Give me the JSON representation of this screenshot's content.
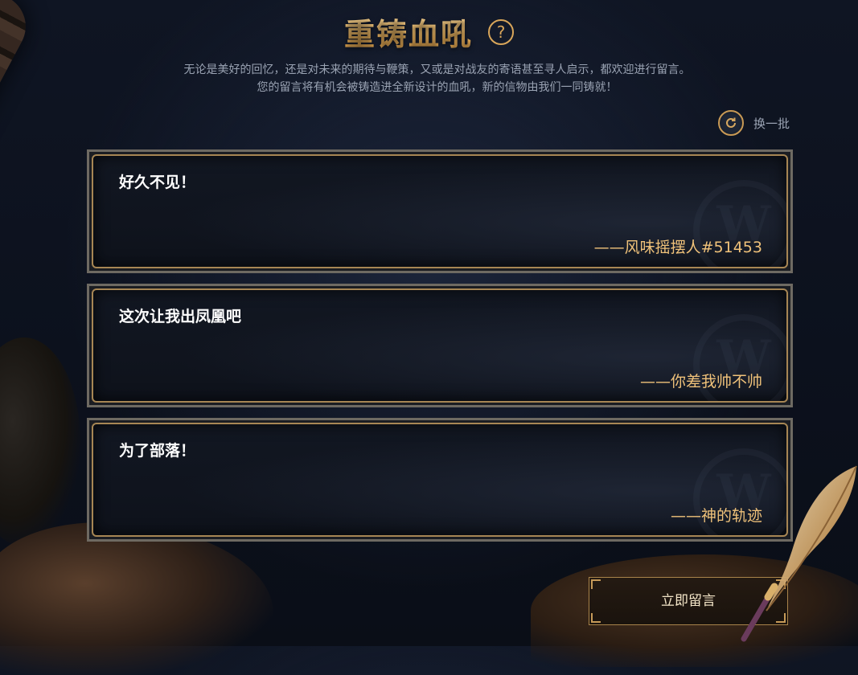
{
  "header": {
    "title": "重铸血吼",
    "help_icon": "question-circle-icon",
    "description_line1": "无论是美好的回忆，还是对未来的期待与鞭策，又或是对战友的寄语甚至寻人启示，都欢迎进行留言。",
    "description_line2": "您的留言将有机会被铸造进全新设计的血吼，新的信物由我们一同铸就！"
  },
  "refresh": {
    "icon": "refresh-icon",
    "label": "换一批"
  },
  "messages": [
    {
      "text": "好久不见！",
      "author": "——风味摇摆人#51453"
    },
    {
      "text": "这次让我出凤凰吧",
      "author": "——你差我帅不帅"
    },
    {
      "text": "为了部落！",
      "author": "——神的轨迹"
    }
  ],
  "cta": {
    "label": "立即留言"
  },
  "colors": {
    "accent_gold": "#f0c27a",
    "background": "#0f1523",
    "text_muted": "#9aa3b3"
  }
}
